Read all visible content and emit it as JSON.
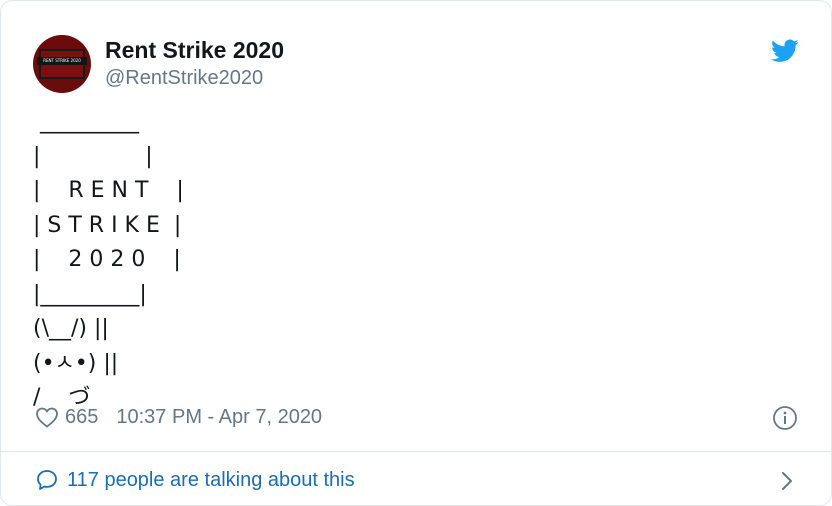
{
  "tweet": {
    "author_name": "Rent Strike 2020",
    "author_handle": "@RentStrike2020",
    "avatar_text": "RENT STRIKE 2020",
    "lines": [
      " _________",
      "|               |",
      "|    R E N T    |",
      "| S T R I K E  |",
      "|    2 0 2 0    |",
      "|_________|",
      "(\\__/) ||",
      "(•ㅅ•) ||",
      "/    づ"
    ],
    "like_count": "665",
    "timestamp": "10:37 PM - Apr 7, 2020",
    "conversation_link": "117 people are talking about this"
  },
  "icons": {
    "logo": "twitter-bird-icon",
    "like": "heart-icon",
    "info": "info-icon",
    "conversation": "speech-bubble-icon",
    "more": "chevron-right-icon"
  },
  "colors": {
    "brand_blue": "#1da1f2",
    "link_blue": "#1b6db1",
    "secondary_text": "#657786",
    "primary_text": "#14171a",
    "border": "#e1e8ed",
    "avatar_red": "#6b0c0c"
  }
}
